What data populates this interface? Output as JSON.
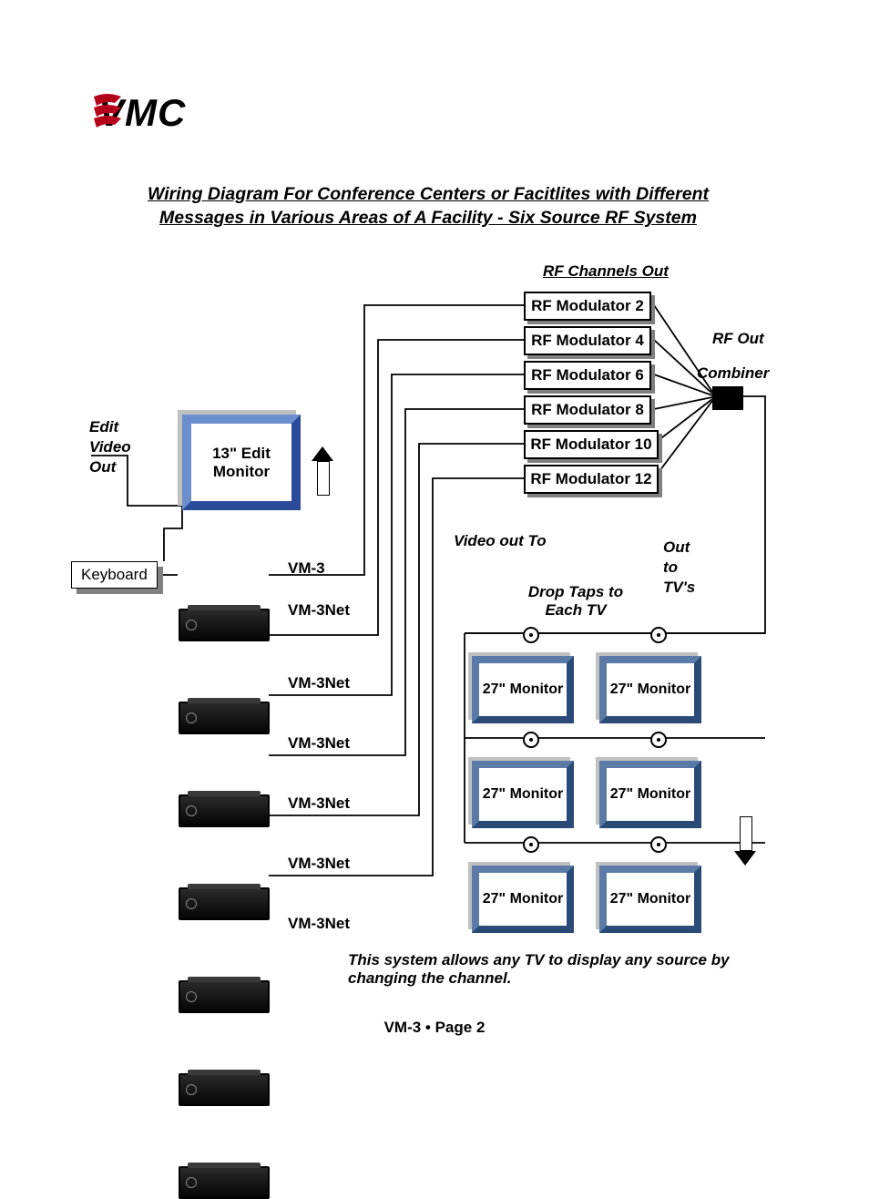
{
  "logo_text": "VMC",
  "title": "Wiring Diagram For Conference Centers or Facitlites with Different Messages in Various Areas of A Facility - Six Source RF System",
  "labels": {
    "rf_channels_out": "RF Channels Out",
    "rf_out": "RF Out",
    "combiner": "Combiner",
    "edit_video_out": "Edit\nVideo\nOut",
    "edit_monitor": "13\" Edit Monitor",
    "keyboard": "Keyboard",
    "video_out_to": "Video out To",
    "drop_taps": "Drop Taps to Each TV",
    "out_to_tvs": "Out\nto\nTV's",
    "monitor27": "27\" Monitor"
  },
  "modulators": [
    {
      "label": "RF Modulator 2"
    },
    {
      "label": "RF Modulator 4"
    },
    {
      "label": "RF Modulator 6"
    },
    {
      "label": "RF Modulator 8"
    },
    {
      "label": "RF Modulator 10"
    },
    {
      "label": "RF Modulator 12"
    }
  ],
  "devices": [
    {
      "label": "VM-3"
    },
    {
      "label": "VM-3Net"
    },
    {
      "label": "VM-3Net"
    },
    {
      "label": "VM-3Net"
    },
    {
      "label": "VM-3Net"
    },
    {
      "label": "VM-3Net"
    },
    {
      "label": "VM-3Net"
    }
  ],
  "description": "This system allows any TV to display any source by changing the channel.",
  "footer": "VM-3 • Page 2"
}
